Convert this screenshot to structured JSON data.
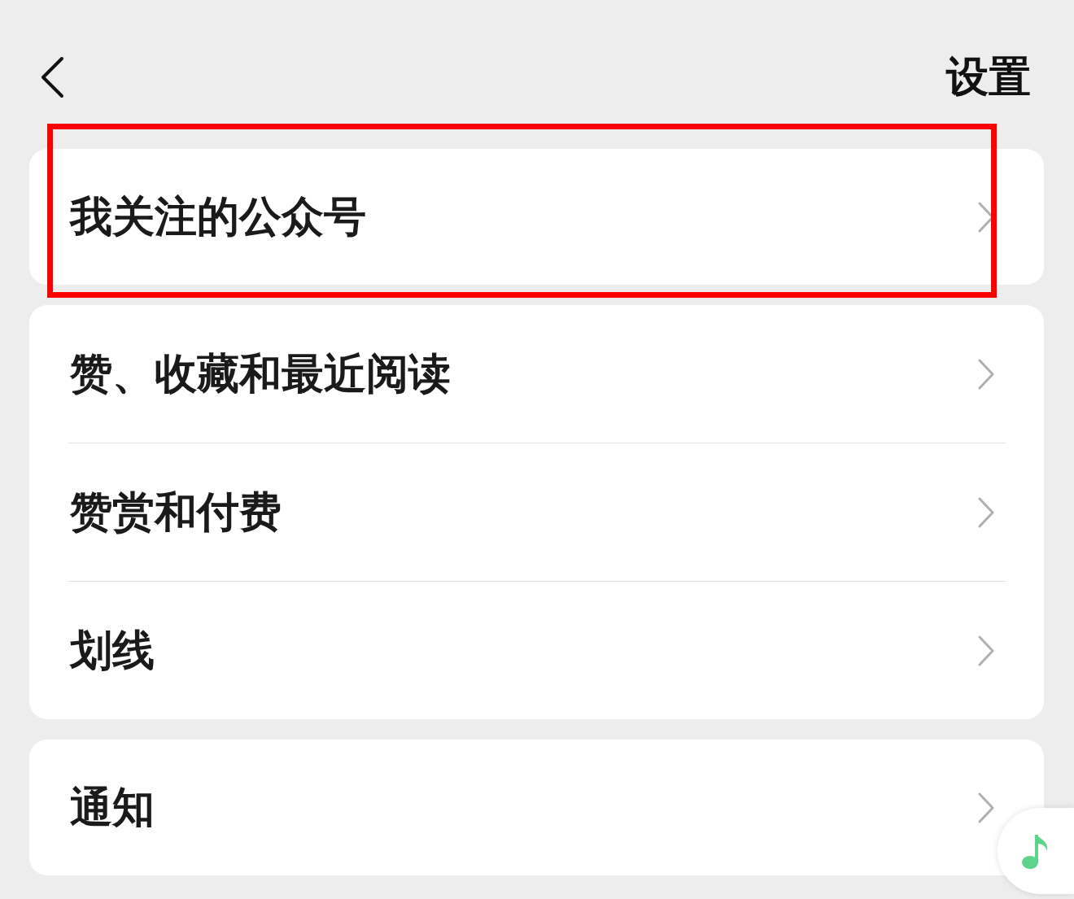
{
  "header": {
    "title": "设置"
  },
  "sections": [
    {
      "items": [
        {
          "label": "我关注的公众号",
          "highlighted": true
        }
      ]
    },
    {
      "items": [
        {
          "label": "赞、收藏和最近阅读",
          "highlighted": false
        },
        {
          "label": "赞赏和付费",
          "highlighted": false
        },
        {
          "label": "划线",
          "highlighted": false
        }
      ]
    },
    {
      "items": [
        {
          "label": "通知",
          "highlighted": false
        }
      ]
    }
  ]
}
